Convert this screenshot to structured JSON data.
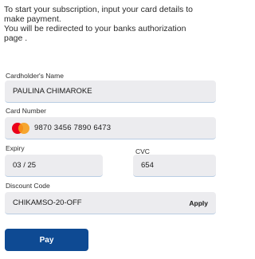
{
  "intro": {
    "line1": "To start your subscription, input your card details to",
    "line2": "make payment.",
    "line3": "You will be redirected to your banks authorization",
    "line4": "page ."
  },
  "form": {
    "cardholder": {
      "label": "Cardholder's Name",
      "value": "PAULINA CHIMAROKE"
    },
    "card_number": {
      "label": "Card Number",
      "value": "9870 3456 7890 6473",
      "brand_icon": "mastercard-icon"
    },
    "expiry": {
      "label": "Expiry",
      "value": "03 / 25"
    },
    "cvc": {
      "label": "CVC",
      "value": "654"
    },
    "discount": {
      "label": "Discount Code",
      "value": "CHIKAMSO-20-OFF",
      "apply_label": "Apply"
    }
  },
  "pay_button": {
    "label": "Pay"
  },
  "colors": {
    "field_bg": "#ececef",
    "field_underline": "#b9cde3",
    "pay_button": "#0e4a93",
    "mastercard_red": "#eb001b",
    "mastercard_orange": "#f79e1b"
  }
}
